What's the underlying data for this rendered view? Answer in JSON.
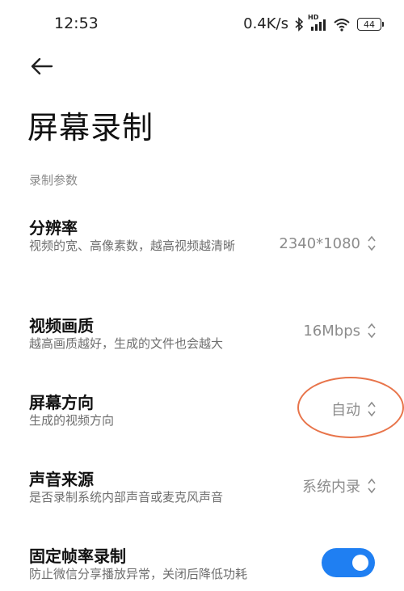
{
  "status_bar": {
    "time": "12:53",
    "network_speed": "0.4K/s",
    "hd_label": "HD",
    "battery": "44",
    "icons": [
      "bluetooth-icon",
      "signal-icon",
      "wifi-icon",
      "battery-icon"
    ]
  },
  "header": {
    "back_icon": "back-arrow-icon",
    "title": "屏幕录制"
  },
  "section": {
    "title": "录制参数"
  },
  "settings": [
    {
      "title": "分辨率",
      "desc": "视频的宽、高像素数，越高视频越清晰",
      "value": "2340*1080"
    },
    {
      "title": "视频画质",
      "desc": "越高画质越好，生成的文件也会越大",
      "value": "16Mbps"
    },
    {
      "title": "屏幕方向",
      "desc": "生成的视频方向",
      "value": "自动"
    },
    {
      "title": "声音来源",
      "desc": "是否录制系统内部声音或麦克风声音",
      "value": "系统内录"
    },
    {
      "title": "固定帧率录制",
      "desc": "防止微信分享播放异常，关闭后降低功耗",
      "toggle_on": true
    }
  ],
  "colors": {
    "accent": "#1f7ff2",
    "highlight_ring": "#e8744a"
  }
}
